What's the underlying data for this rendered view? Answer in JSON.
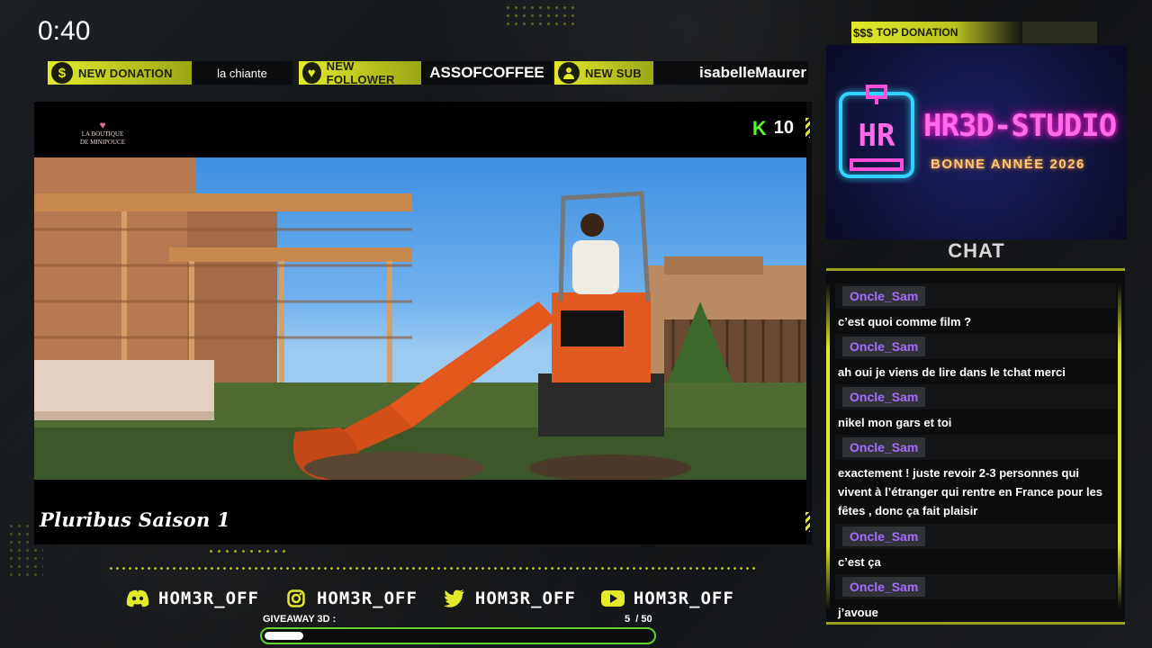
{
  "timer": "0:40",
  "alerts": {
    "donation": {
      "icon": "dollar-icon",
      "label": "NEW DONATION",
      "value": "la chiante"
    },
    "follower": {
      "icon": "heart-icon",
      "label": "NEW FOLLOWER",
      "value": "ASSOFCOFFEE"
    },
    "sub": {
      "icon": "users-icon",
      "label": "NEW SUB",
      "value": "isabelleMaurer"
    }
  },
  "video": {
    "logo_text": "LA BOUTIQUE DE MINIPOUCE",
    "kick_count": "10",
    "title": "Pluribus Saison 1"
  },
  "socials": [
    {
      "icon": "discord-icon",
      "handle": "HOM3R_OFF"
    },
    {
      "icon": "instagram-icon",
      "handle": "HOM3R_OFF"
    },
    {
      "icon": "twitter-icon",
      "handle": "HOM3R_OFF"
    },
    {
      "icon": "youtube-icon",
      "handle": "HOM3R_OFF"
    }
  ],
  "giveaway": {
    "label": "GIVEAWAY 3D :",
    "count_text": "5  / 50",
    "current": 5,
    "goal": 50
  },
  "top_donation": {
    "icon": "money-icon",
    "icon_text": "$$$",
    "label": "TOP DONATION"
  },
  "sponsor": {
    "name": "HR3D-STUDIO",
    "subtitle": "BONNE ANNÉE 2026",
    "logo_text": "HR"
  },
  "chat": {
    "title": "CHAT",
    "messages": [
      {
        "user": "Oncle_Sam",
        "text": "c’est quoi comme film ?"
      },
      {
        "user": "Oncle_Sam",
        "text": "ah oui je viens de lire dans le tchat merci"
      },
      {
        "user": "Oncle_Sam",
        "text": "nikel mon gars et toi"
      },
      {
        "user": "Oncle_Sam",
        "text": "exactement ! juste revoir 2-3 personnes qui vivent à l’étranger qui rentre en France pour les fêtes , donc ça fait plaisir"
      },
      {
        "user": "Oncle_Sam",
        "text": "c’est ça"
      },
      {
        "user": "Oncle_Sam",
        "text": "j’avoue"
      }
    ]
  },
  "colors": {
    "accent": "#e2ea2a",
    "kick_green": "#53fc18",
    "chat_user": "#a56bff",
    "progress_border": "#61d330"
  }
}
